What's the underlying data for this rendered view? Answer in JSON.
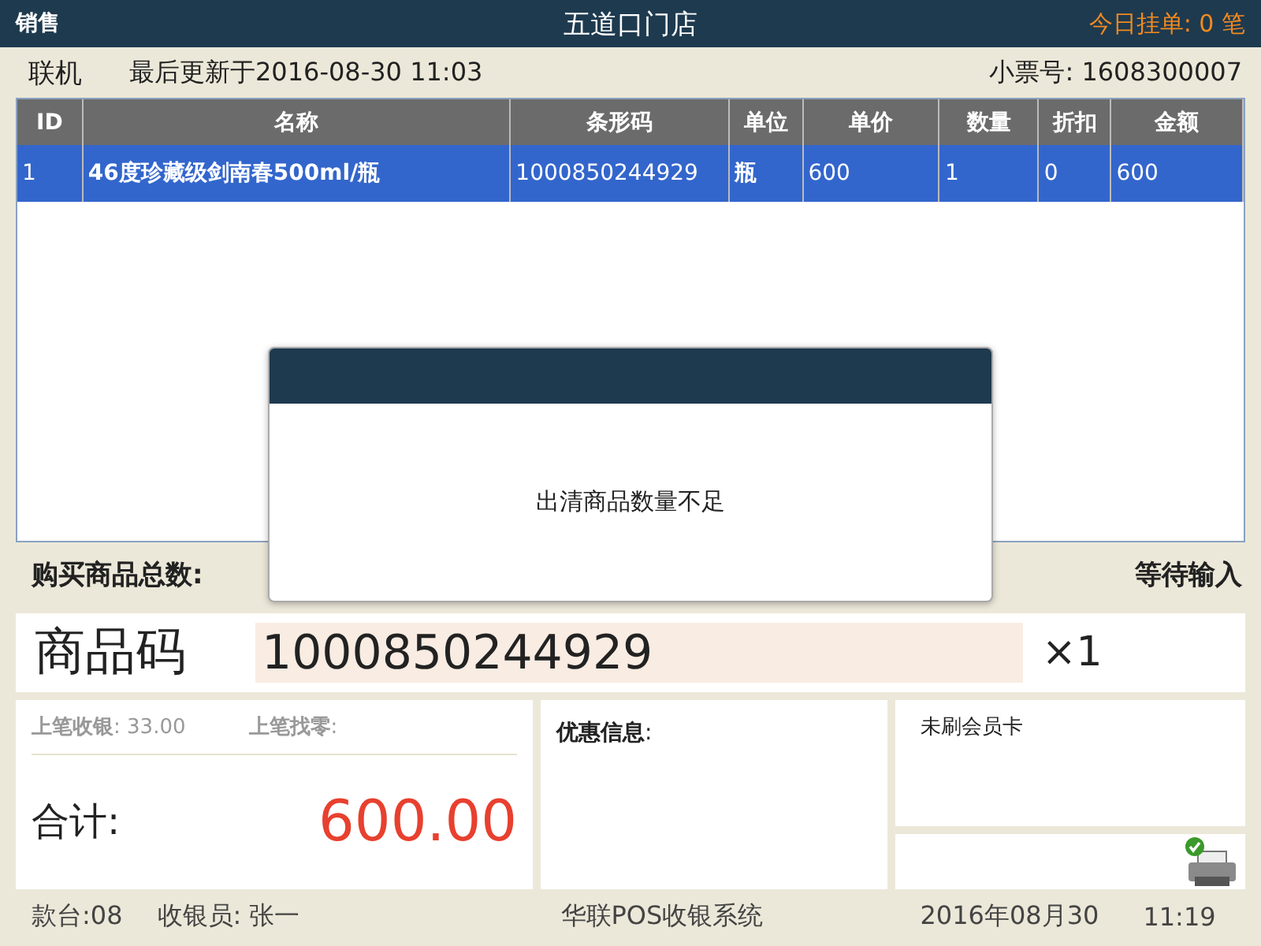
{
  "header": {
    "mode": "销售",
    "store": "五道口门店",
    "pending_label": "今日挂单:",
    "pending_count": "0",
    "pending_unit": "笔"
  },
  "info_bar": {
    "status": "联机",
    "last_update": "最后更新于2016-08-30 11:03",
    "receipt_label": "小票号:",
    "receipt_no": "1608300007"
  },
  "table": {
    "columns": [
      "ID",
      "名称",
      "条形码",
      "单位",
      "单价",
      "数量",
      "折扣",
      "金额"
    ],
    "rows": [
      {
        "selected": true,
        "cells": [
          "1",
          "46度珍藏级剑南春500ml/瓶",
          "1000850244929",
          "瓶",
          "600",
          "1",
          "0",
          "600"
        ]
      }
    ]
  },
  "summary": {
    "total_label": "购买商品总数:",
    "status": "等待输入"
  },
  "product_code": {
    "label": "商品码",
    "value": "1000850244929",
    "multiplier": "×1"
  },
  "last_sale": {
    "paid_label": "**上笔收银**:",
    "paid_value": "33.00",
    "change_label": "**上笔找零**:"
  },
  "total": {
    "label": "合计:",
    "value": "600.00"
  },
  "promo": {
    "label": "**优惠信息**:"
  },
  "member": {
    "text": "未刷会员卡"
  },
  "printer": {
    "ok": true
  },
  "footer": {
    "counter": "款台:08",
    "cashier": "收银员: 张一",
    "system": "华联POS收银系统",
    "date": "2016年08月30",
    "time": "11:19"
  },
  "dialog": {
    "message": "出清商品数量不足"
  }
}
